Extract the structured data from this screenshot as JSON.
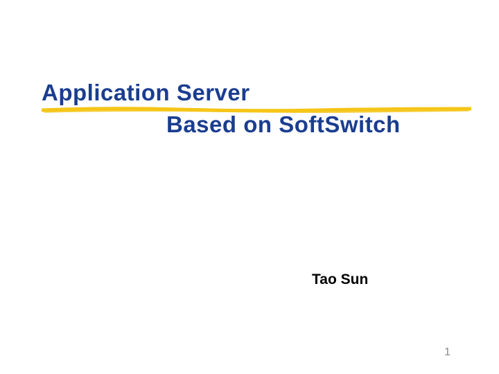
{
  "slide": {
    "title_line_1": "Application Server",
    "title_line_2": "Based on SoftSwitch",
    "author": "Tao Sun",
    "page_number": "1"
  },
  "colors": {
    "title": "#1a3d8f",
    "underline": "#f5c518",
    "author": "#000000",
    "page_number": "#888888"
  }
}
